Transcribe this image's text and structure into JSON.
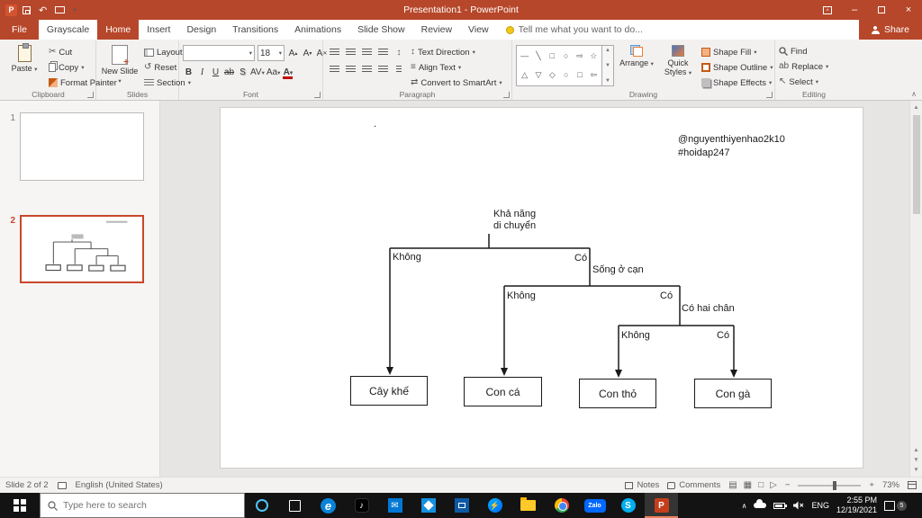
{
  "titlebar": {
    "title": "Presentation1 - PowerPoint"
  },
  "tabs": {
    "items": [
      "File",
      "Grayscale",
      "Home",
      "Insert",
      "Design",
      "Transitions",
      "Animations",
      "Slide Show",
      "Review",
      "View"
    ],
    "tell_me": "Tell me what you want to do...",
    "share": "Share"
  },
  "ribbon": {
    "clipboard": {
      "group": "Clipboard",
      "paste": "Paste",
      "cut": "Cut",
      "copy": "Copy",
      "format_painter": "Format Painter"
    },
    "slides": {
      "group": "Slides",
      "new_slide": "New Slide",
      "layout": "Layout",
      "reset": "Reset",
      "section": "Section"
    },
    "font": {
      "group": "Font",
      "size": "18"
    },
    "paragraph": {
      "group": "Paragraph",
      "text_direction": "Text Direction",
      "align_text": "Align Text",
      "smartart": "Convert to SmartArt"
    },
    "drawing": {
      "group": "Drawing",
      "arrange": "Arrange",
      "quick_styles": "Quick Styles",
      "shape_fill": "Shape Fill",
      "shape_outline": "Shape Outline",
      "shape_effects": "Shape Effects"
    },
    "editing": {
      "group": "Editing",
      "find": "Find",
      "replace": "Replace",
      "select": "Select"
    }
  },
  "thumbnails": {
    "slide1_number": "1",
    "slide2_number": "2"
  },
  "slide": {
    "dot": ".",
    "handle": "@nguyenthiyenhao2k10",
    "hashtag": "#hoidap247",
    "tree": {
      "root_line1": "Khả năng",
      "root_line2": "di chuyển",
      "no": "Không",
      "yes": "Có",
      "branch_land": "Sống ở cạn",
      "branch_two_legs": "Có hai chân",
      "leaf_starfruit_tree": "Cây khế",
      "leaf_fish": "Con cá",
      "leaf_rabbit": "Con thỏ",
      "leaf_chicken": "Con gà"
    }
  },
  "statusbar": {
    "slide_info": "Slide 2 of 2",
    "language": "English (United States)",
    "notes": "Notes",
    "comments": "Comments",
    "zoom": "73%"
  },
  "taskbar": {
    "search_placeholder": "Type here to search",
    "zalo": "Zalo",
    "lang": "ENG",
    "time": "2:55 PM",
    "date": "12/19/2021",
    "badge": "5"
  },
  "colors": {
    "accent": "#B7472A",
    "taskbar": "#131313"
  }
}
